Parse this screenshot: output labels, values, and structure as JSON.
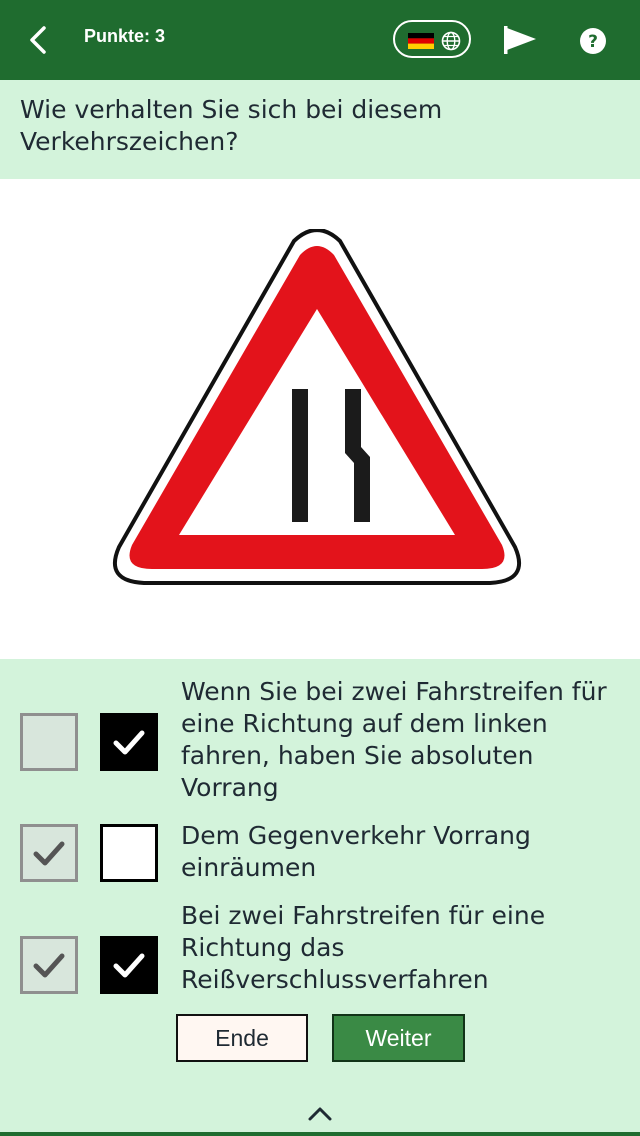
{
  "header": {
    "score_label": "Punkte: 3",
    "back_icon": "chevron-left-icon",
    "language_flag": "germany-flag-icon",
    "language_icon": "globe-icon",
    "report_icon": "flag-icon",
    "help_icon": "question-mark-icon"
  },
  "question": {
    "text": "Wie verhalten Sie sich bei diesem Verkehrszeichen?"
  },
  "sign": {
    "icon": "road-narrows-right-warning-sign",
    "border_color": "#e3131b"
  },
  "answers": [
    {
      "text": "Wenn Sie bei zwei Fahrstreifen für eine Richtung auf dem linken fahren, haben Sie absoluten Vorrang",
      "user_checked": false,
      "correct_checked": true
    },
    {
      "text": "Dem Gegenverkehr Vorrang einräumen",
      "user_checked": true,
      "correct_checked": false
    },
    {
      "text": "Bei zwei Fahrstreifen für eine Richtung das Reißverschlussverfahren",
      "user_checked": true,
      "correct_checked": true
    }
  ],
  "buttons": {
    "end_label": "Ende",
    "next_label": "Weiter"
  },
  "colors": {
    "header_bg": "#1f6c2f",
    "page_bg": "#d3f3db",
    "next_button_bg": "#3a8a45"
  }
}
